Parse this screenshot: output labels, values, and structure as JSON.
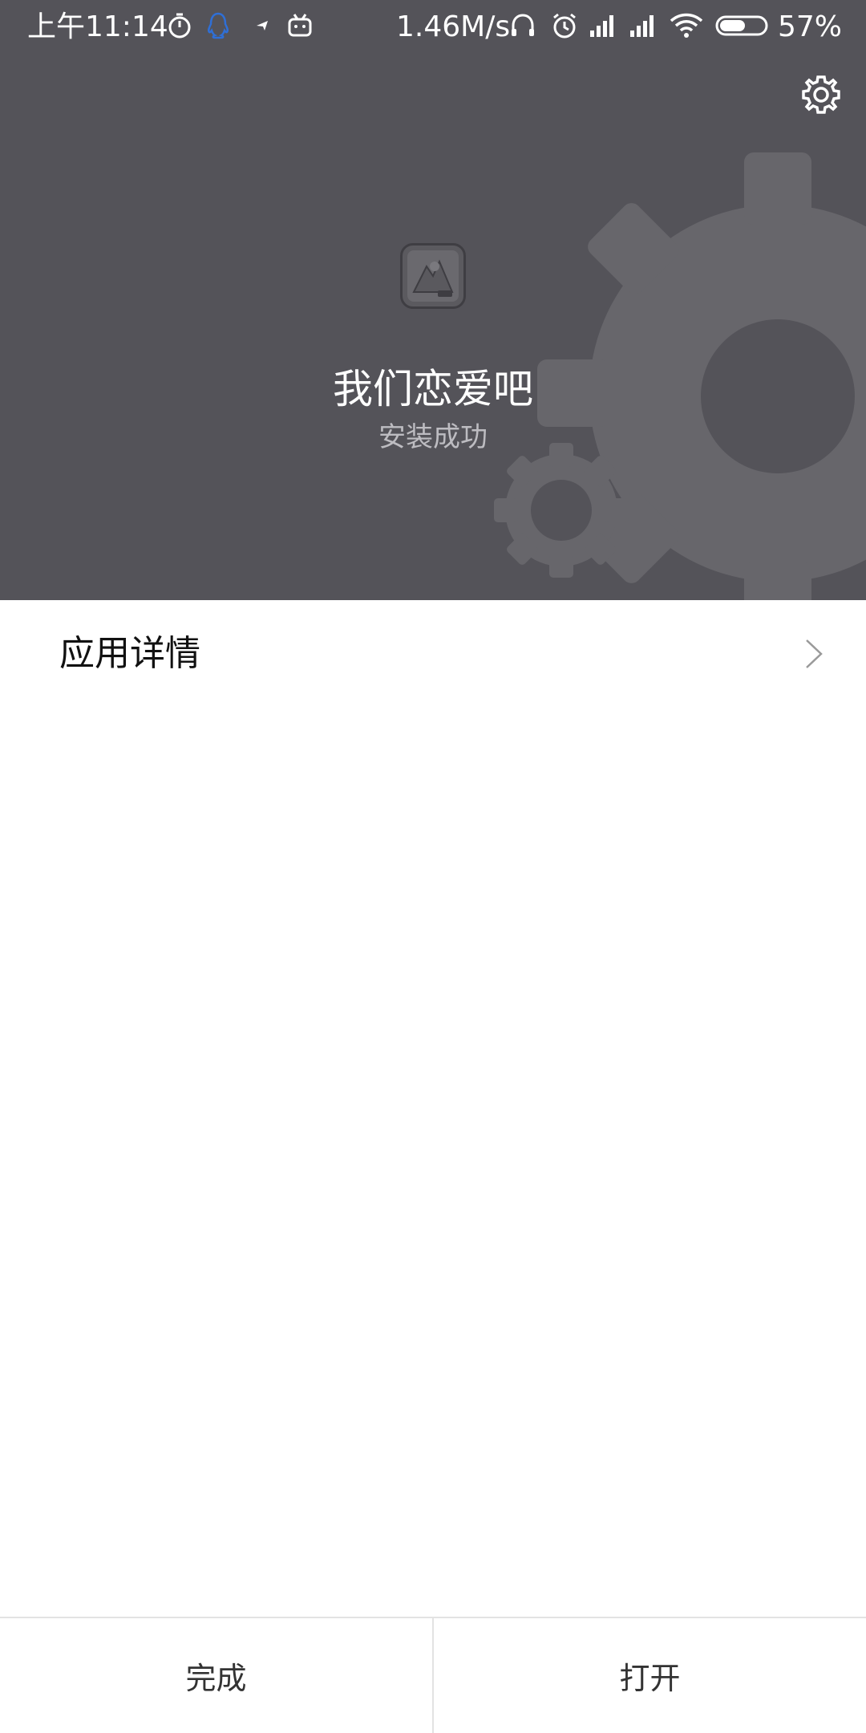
{
  "status_bar": {
    "time": "上午11:14",
    "network_speed": "1.46M/s",
    "battery_percent": "57%",
    "battery_level": 0.57,
    "icons_left": [
      "stopwatch-icon",
      "qq-icon",
      "message-icon",
      "bilibili-icon"
    ],
    "icons_right": [
      "headset-icon",
      "alarm-icon",
      "signal-icon",
      "signal-icon",
      "wifi-icon",
      "battery-icon"
    ]
  },
  "header": {
    "app_name": "我们恋爱吧",
    "install_status": "安装成功",
    "settings_icon": "gear-icon",
    "background_color": "#545359"
  },
  "details": {
    "label": "应用详情",
    "icon": "chevron-right-icon"
  },
  "buttons": {
    "done": "完成",
    "open": "打开"
  }
}
